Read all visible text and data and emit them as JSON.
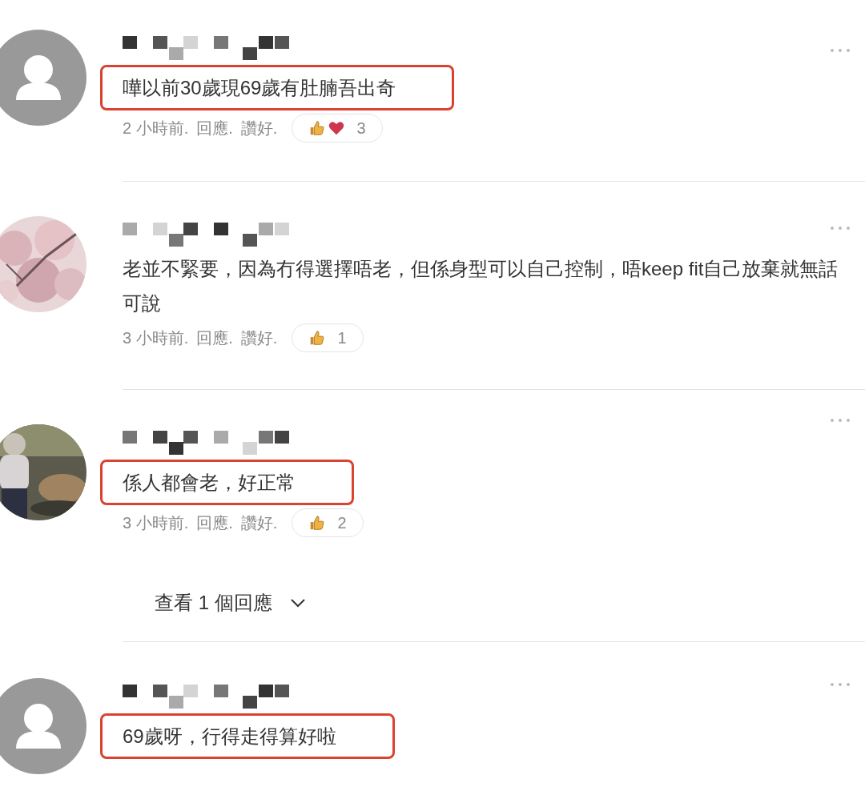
{
  "comments": [
    {
      "avatar": {
        "kind": "default"
      },
      "text": "嘩以前30歲現69歲有肚腩吾出奇",
      "highlighted": true,
      "meta": {
        "time": "2 小時前.",
        "reply": "回應.",
        "like": "讚好."
      },
      "reactions": [
        {
          "kind": "like"
        },
        {
          "kind": "love"
        }
      ],
      "reaction_count": "3"
    },
    {
      "avatar": {
        "kind": "picture"
      },
      "text": "老並不緊要，因為冇得選擇唔老，但係身型可以自己控制，唔keep fit自己放棄就無話可說",
      "highlighted": false,
      "meta": {
        "time": "3 小時前.",
        "reply": "回應.",
        "like": "讚好."
      },
      "reactions": [
        {
          "kind": "like"
        }
      ],
      "reaction_count": "1"
    },
    {
      "avatar": {
        "kind": "picture"
      },
      "text": "係人都會老，好正常",
      "highlighted": true,
      "meta": {
        "time": "3 小時前.",
        "reply": "回應.",
        "like": "讚好."
      },
      "reactions": [
        {
          "kind": "like"
        }
      ],
      "reaction_count": "2",
      "view_replies": {
        "label": "查看 1 個回應"
      }
    },
    {
      "avatar": {
        "kind": "default"
      },
      "text": "69歲呀，行得走得算好啦",
      "highlighted": true
    }
  ]
}
